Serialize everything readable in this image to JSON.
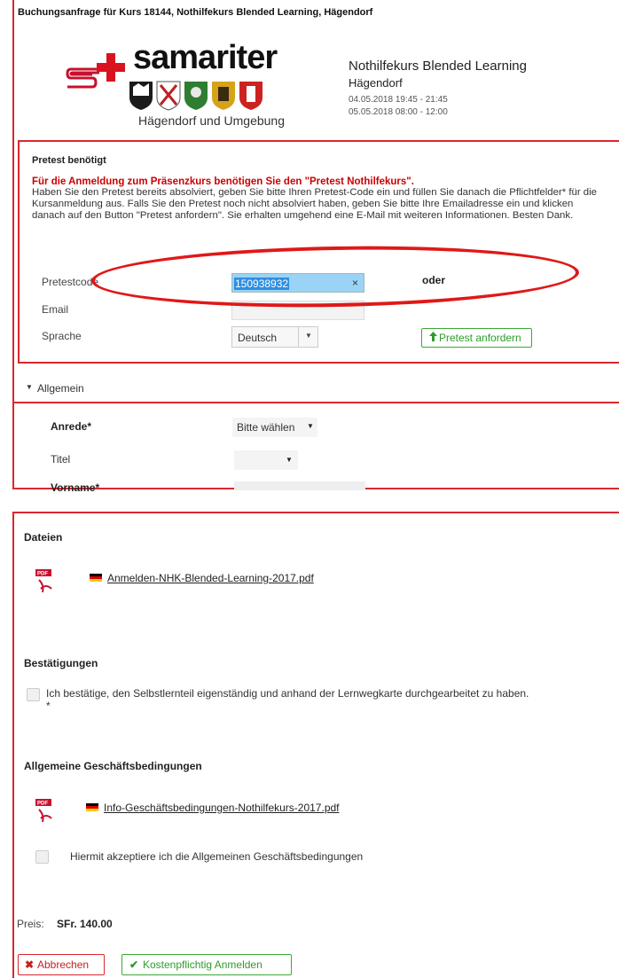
{
  "header": {
    "title": "Buchungsanfrage für Kurs 18144, Nothilfekurs Blended Learning, Hägendorf"
  },
  "logo": {
    "brand": "samariter",
    "subline": "Hägendorf und Umgebung"
  },
  "course": {
    "name": "Nothilfekurs Blended Learning",
    "place": "Hägendorf",
    "dates": [
      "04.05.2018 19:45 - 21:45",
      "05.05.2018 08:00 - 12:00"
    ]
  },
  "pretest": {
    "heading": "Pretest benötigt",
    "notice": "Für die Anmeldung zum Präsenzkurs benötigen Sie den \"Pretest Nothilfekurs\".",
    "description": "Haben Sie den Pretest bereits absolviert, geben Sie bitte Ihren Pretest-Code ein und füllen Sie danach die Pflichtfelder* für die Kursanmeldung aus. Falls Sie den Pretest noch nicht absolviert haben, geben Sie bitte Ihre Emailadresse ein und klicken danach auf den Button \"Pretest anfordern\". Sie erhalten umgehend eine E-Mail mit weiteren Informationen. Besten Dank.",
    "code_label": "Pretestcode",
    "code_value": "150938932",
    "clear_glyph": "×",
    "email_label": "Email",
    "email_value": "",
    "language_label": "Sprache",
    "language_value": "Deutsch",
    "or_label": "oder",
    "request_button": "Pretest anfordern"
  },
  "general": {
    "section_title": "Allgemein",
    "salutation_label": "Anrede*",
    "salutation_value": "Bitte wählen",
    "title_label": "Titel",
    "title_value": "",
    "firstname_label": "Vorname*"
  },
  "files": {
    "heading": "Dateien",
    "file_name": "Anmelden-NHK-Blended-Learning-2017.pdf"
  },
  "confirmations": {
    "heading": "Bestätigungen",
    "text": "Ich bestätige, den Selbstlernteil eigenständig und anhand der Lernwegkarte durchgearbeitet zu haben.",
    "required_mark": "*"
  },
  "terms": {
    "heading": "Allgemeine Geschäftsbedingungen",
    "file_name": "Info-Geschäftsbedingungen-Nothilfekurs-2017.pdf",
    "accept_text": "Hiermit akzeptiere ich die Allgemeinen Geschäftsbedingungen"
  },
  "price": {
    "label": "Preis:",
    "value": "SFr. 140.00"
  },
  "actions": {
    "cancel": "Abbrechen",
    "submit": "Kostenpflichtig Anmelden"
  },
  "colors": {
    "accent_red": "#d9282f",
    "success_green": "#3aaa35",
    "highlight_blue": "#2f8fe0"
  },
  "icons": {
    "pdf": "pdf-file-icon",
    "flag": "german-flag-icon",
    "caret": "caret-down-icon",
    "upload": "upload-arrow-icon",
    "cancel": "cross-icon",
    "submit": "checkmark-icon"
  }
}
